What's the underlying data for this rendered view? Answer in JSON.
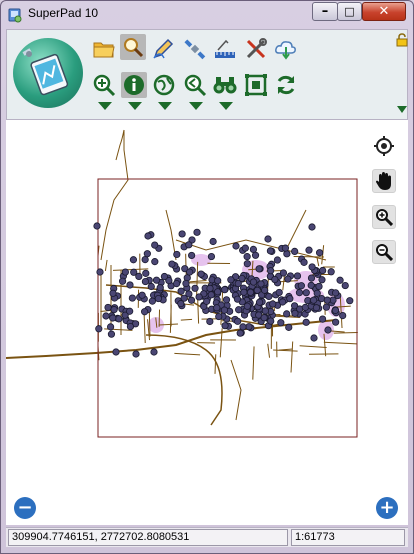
{
  "window": {
    "title": "SuperPad 10",
    "controls": {
      "minimize": "–",
      "maximize": "□",
      "close": "✕"
    }
  },
  "toolbar": {
    "row1": [
      "open-folder-icon",
      "query-icon",
      "edit-pen-icon",
      "satellite-icon",
      "measure-icon",
      "tools-icon",
      "cloud-download-icon"
    ],
    "row2": [
      "zoom-in-icon",
      "info-icon",
      "globe-icon",
      "zoom-search-icon",
      "binoculars-icon",
      "select-extent-icon",
      "refresh-icon"
    ],
    "active_row1": "query-icon",
    "active_row2": "info-icon"
  },
  "map": {
    "buttons": [
      "locate-icon",
      "pan-hand-icon",
      "zoom-in-icon",
      "zoom-out-icon"
    ],
    "zoom_out_symbol": "−",
    "zoom_in_symbol": "+",
    "colors": {
      "roads": "#7a5312",
      "points": "#4a4673",
      "point_stroke": "#1a1a2e",
      "extent_border": "#7a2020",
      "areas": "#e6c3ee"
    }
  },
  "status": {
    "coordinates": "309904.7746151, 2772702.8080531",
    "scale": "1:61773"
  },
  "colors": {
    "accent": "#1d6b2a",
    "close": "#c8432d"
  }
}
